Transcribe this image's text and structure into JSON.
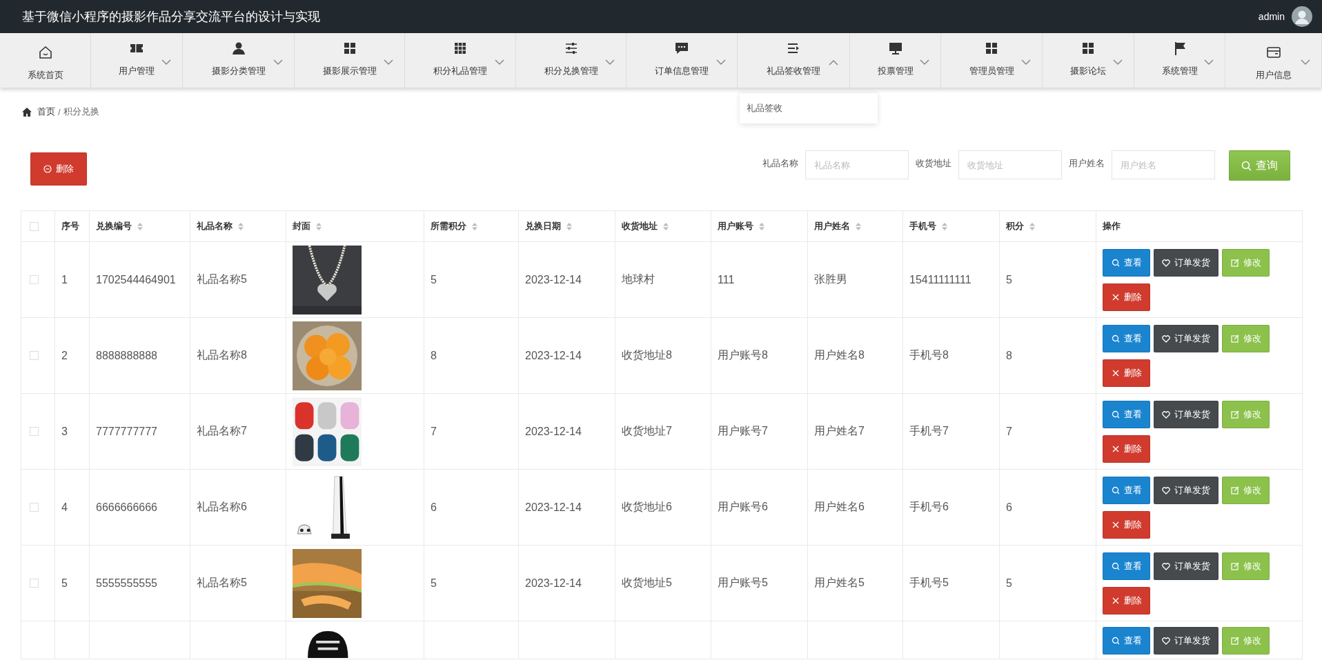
{
  "header": {
    "title": "基于微信小程序的摄影作品分享交流平台的设计与实现",
    "user": "admin"
  },
  "nav": [
    {
      "label": "系统首页"
    },
    {
      "label": "用户管理",
      "expanded": false
    },
    {
      "label": "摄影分类管理",
      "expanded": false
    },
    {
      "label": "摄影展示管理",
      "expanded": false
    },
    {
      "label": "积分礼品管理",
      "expanded": false
    },
    {
      "label": "积分兑换管理",
      "expanded": false
    },
    {
      "label": "订单信息管理",
      "expanded": false
    },
    {
      "label": "礼品签收管理",
      "expanded": true,
      "submenu": [
        "礼品签收"
      ]
    },
    {
      "label": "投票管理",
      "expanded": false
    },
    {
      "label": "管理员管理",
      "expanded": false
    },
    {
      "label": "摄影论坛",
      "expanded": false
    },
    {
      "label": "系统管理",
      "expanded": false
    },
    {
      "label": "用户信息",
      "expanded": false
    }
  ],
  "breadcrumb": {
    "items": [
      "首页",
      "积分兑换"
    ],
    "separator": "/"
  },
  "toolbar": {
    "delete_button": "删除",
    "filters": [
      {
        "label": "礼品名称",
        "placeholder": "礼品名称"
      },
      {
        "label": "收货地址",
        "placeholder": "收货地址"
      },
      {
        "label": "用户姓名",
        "placeholder": "用户姓名"
      }
    ],
    "search_button": "查询"
  },
  "table": {
    "select_all": {
      "checked": false
    },
    "columns": [
      {
        "label": "序号",
        "sortable": false
      },
      {
        "label": "兑换编号",
        "sortable": true
      },
      {
        "label": "礼品名称",
        "sortable": true
      },
      {
        "label": "封面",
        "sortable": true
      },
      {
        "label": "所需积分",
        "sortable": true
      },
      {
        "label": "兑换日期",
        "sortable": true
      },
      {
        "label": "收货地址",
        "sortable": true
      },
      {
        "label": "用户账号",
        "sortable": true
      },
      {
        "label": "用户姓名",
        "sortable": true
      },
      {
        "label": "手机号",
        "sortable": true
      },
      {
        "label": "积分",
        "sortable": true
      },
      {
        "label": "操作",
        "sortable": false
      }
    ],
    "rows": [
      {
        "checked": false,
        "cells": [
          "1",
          "1702544464901",
          "礼品名称5",
          {
            "kind": "picture"
          },
          "5",
          "2023-12-14",
          "地球村",
          "111",
          "张胜男",
          "15411111111",
          "5"
        ],
        "actions": [
          "查看",
          "订单发货",
          "修改",
          "删除"
        ]
      },
      {
        "checked": false,
        "cells": [
          "2",
          "8888888888",
          "礼品名称8",
          {
            "kind": "picture"
          },
          "8",
          "2023-12-14",
          "收货地址8",
          "用户账号8",
          "用户姓名8",
          "手机号8",
          "8"
        ],
        "actions": [
          "查看",
          "订单发货",
          "修改",
          "删除"
        ]
      },
      {
        "checked": false,
        "cells": [
          "3",
          "7777777777",
          "礼品名称7",
          {
            "kind": "picture"
          },
          "7",
          "2023-12-14",
          "收货地址7",
          "用户账号7",
          "用户姓名7",
          "手机号7",
          "7"
        ],
        "actions": [
          "查看",
          "订单发货",
          "修改",
          "删除"
        ]
      },
      {
        "checked": false,
        "cells": [
          "4",
          "6666666666",
          "礼品名称6",
          {
            "kind": "picture"
          },
          "6",
          "2023-12-14",
          "收货地址6",
          "用户账号6",
          "用户姓名6",
          "手机号6",
          "6"
        ],
        "actions": [
          "查看",
          "订单发货",
          "修改",
          "删除"
        ]
      },
      {
        "checked": false,
        "cells": [
          "5",
          "5555555555",
          "礼品名称5",
          {
            "kind": "picture"
          },
          "5",
          "2023-12-14",
          "收货地址5",
          "用户账号5",
          "用户姓名5",
          "手机号5",
          "5"
        ],
        "actions": [
          "查看",
          "订单发货",
          "修改",
          "删除"
        ]
      },
      {
        "partial": true,
        "cells": [
          "",
          "",
          "",
          {
            "kind": "picture"
          },
          "",
          "",
          "",
          "",
          "",
          "",
          "",
          ""
        ],
        "actions": [
          "查看",
          "订单发货",
          "修改"
        ]
      }
    ]
  }
}
